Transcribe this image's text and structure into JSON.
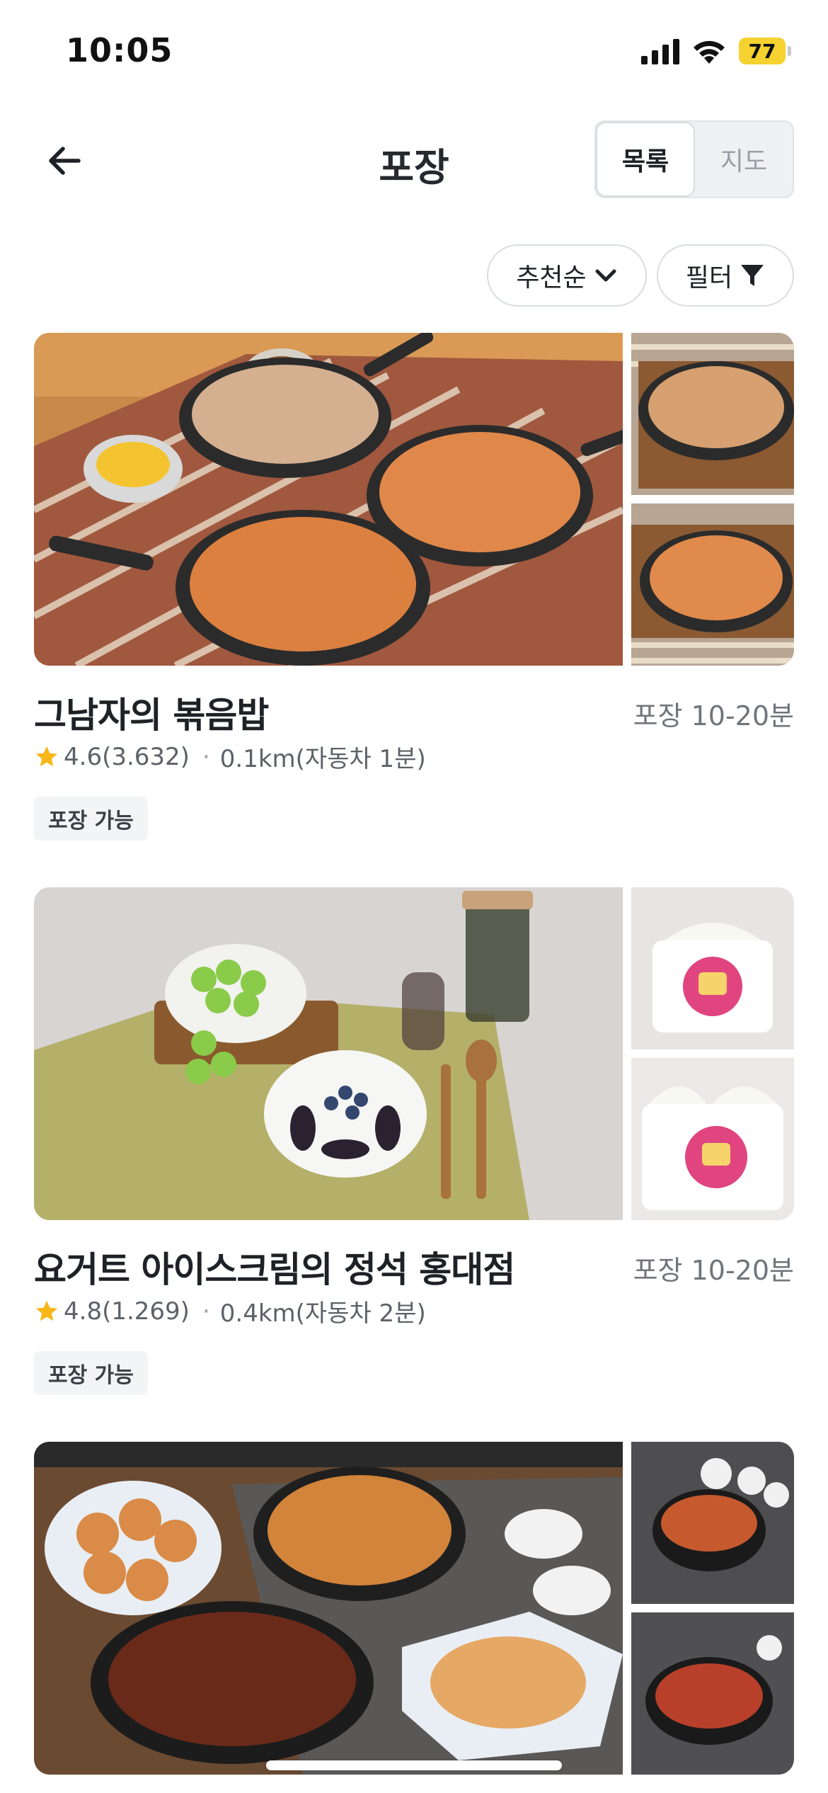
{
  "status_bar": {
    "time": "10:05",
    "battery": "77",
    "icons": [
      "signal-icon",
      "wifi-icon",
      "battery-icon"
    ]
  },
  "header": {
    "title": "포장",
    "back_icon": "arrow-left-icon",
    "toggle": {
      "list_label": "목록",
      "map_label": "지도",
      "selected": "목록"
    }
  },
  "filters": {
    "sort_label": "추천순",
    "sort_icon": "chevron-down-icon",
    "filter_label": "필터",
    "filter_icon": "funnel-icon"
  },
  "stores": [
    {
      "name": "그남자의 볶음밥",
      "time": "포장 10-20분",
      "rating": "4.6",
      "reviews": "(3.632)",
      "distance": "0.1km(자동차 1분)",
      "badge": "포장 가능"
    },
    {
      "name": "요거트 아이스크림의 정석 홍대점",
      "time": "포장 10-20분",
      "rating": "4.8",
      "reviews": "(1.269)",
      "distance": "0.4km(자동차 2분)",
      "badge": "포장 가능"
    },
    {
      "name": "",
      "time": "",
      "rating": "",
      "reviews": "",
      "distance": "",
      "badge": ""
    }
  ],
  "colors": {
    "accent_star": "#f7b718",
    "battery": "#f5d22f",
    "badge_bg": "#f2f4f6",
    "text_primary": "#1e2227",
    "text_secondary": "#6f757b"
  }
}
